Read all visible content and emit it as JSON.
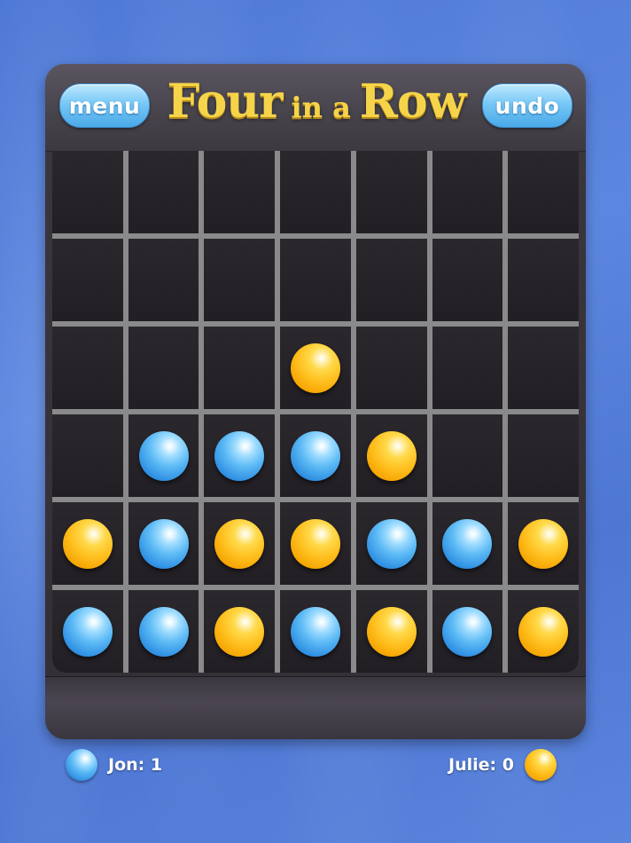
{
  "header": {
    "title_part1": "Four",
    "title_part2": "in a",
    "title_part3": "Row",
    "menu_label": "menu",
    "undo_label": "undo"
  },
  "board": {
    "columns": 7,
    "rows": 6,
    "cells": [
      [
        "",
        "",
        "",
        "",
        "",
        "",
        ""
      ],
      [
        "",
        "",
        "",
        "",
        "",
        "",
        ""
      ],
      [
        "",
        "",
        "",
        "yellow",
        "",
        "",
        ""
      ],
      [
        "",
        "blue",
        "blue",
        "blue",
        "yellow",
        "",
        ""
      ],
      [
        "yellow",
        "blue",
        "yellow",
        "yellow",
        "blue",
        "blue",
        "yellow"
      ],
      [
        "blue",
        "blue",
        "yellow",
        "blue",
        "yellow",
        "blue",
        "yellow"
      ]
    ]
  },
  "players": [
    {
      "name_score": "Jon: 1",
      "color": "blue"
    },
    {
      "name_score": "Julie: 0",
      "color": "yellow"
    }
  ],
  "colors": {
    "blue_disc": "#4aa9e8",
    "yellow_disc": "#ffc01f",
    "background": "#5580da",
    "frame": "#3a363d",
    "grid_lines": "#8a8a8c"
  }
}
